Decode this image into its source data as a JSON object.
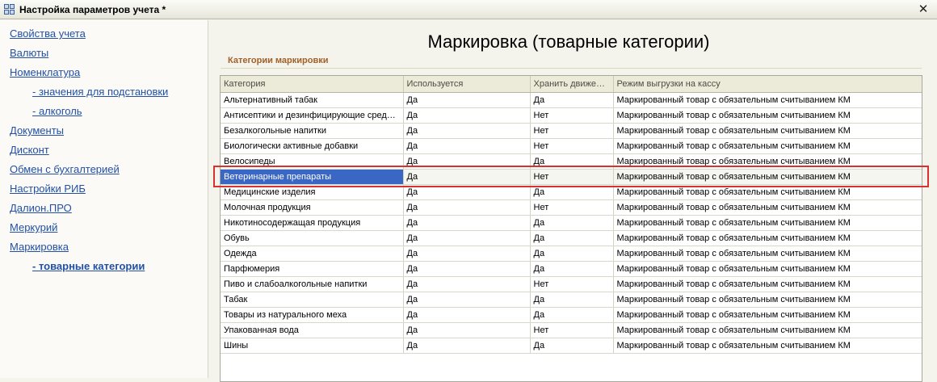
{
  "window": {
    "title": "Настройка параметров учета *"
  },
  "sidebar": {
    "items": [
      {
        "label": "Свойства учета",
        "level": 0,
        "active": false
      },
      {
        "label": "Валюты",
        "level": 0,
        "active": false
      },
      {
        "label": "Номенклатура",
        "level": 0,
        "active": false
      },
      {
        "label": "- значения для подстановки",
        "level": 1,
        "active": false
      },
      {
        "label": "- алкоголь",
        "level": 1,
        "active": false
      },
      {
        "label": "Документы",
        "level": 0,
        "active": false
      },
      {
        "label": "Дисконт",
        "level": 0,
        "active": false
      },
      {
        "label": "Обмен с бухгалтерией",
        "level": 0,
        "active": false
      },
      {
        "label": "Настройки РИБ",
        "level": 0,
        "active": false
      },
      {
        "label": "Далион.ПРО",
        "level": 0,
        "active": false
      },
      {
        "label": "Меркурий",
        "level": 0,
        "active": false
      },
      {
        "label": "Маркировка",
        "level": 0,
        "active": false
      },
      {
        "label": "- товарные категории",
        "level": 1,
        "active": true
      }
    ]
  },
  "main": {
    "title": "Маркировка (товарные категории)",
    "section_label": "Категории маркировки"
  },
  "table": {
    "columns": [
      "Категория",
      "Используется",
      "Хранить движени...",
      "Режим выгрузки на кассу"
    ],
    "selected_row": 5,
    "rows": [
      [
        "Альтернативный табак",
        "Да",
        "Да",
        "Маркированный товар с обязательным считыванием КМ"
      ],
      [
        "Антисептики и дезинфицирующие средст...",
        "Да",
        "Нет",
        "Маркированный товар с обязательным считыванием КМ"
      ],
      [
        "Безалкогольные напитки",
        "Да",
        "Нет",
        "Маркированный товар с обязательным считыванием КМ"
      ],
      [
        "Биологически активные добавки",
        "Да",
        "Нет",
        "Маркированный товар с обязательным считыванием КМ"
      ],
      [
        "Велосипеды",
        "Да",
        "Да",
        "Маркированный товар с обязательным считыванием КМ"
      ],
      [
        "Ветеринарные препараты",
        "Да",
        "Нет",
        "Маркированный товар с обязательным считыванием КМ"
      ],
      [
        "Медицинские изделия",
        "Да",
        "Да",
        "Маркированный товар с обязательным считыванием КМ"
      ],
      [
        "Молочная продукция",
        "Да",
        "Нет",
        "Маркированный товар с обязательным считыванием КМ"
      ],
      [
        "Никотиносодержащая продукция",
        "Да",
        "Да",
        "Маркированный товар с обязательным считыванием КМ"
      ],
      [
        "Обувь",
        "Да",
        "Да",
        "Маркированный товар с обязательным считыванием КМ"
      ],
      [
        "Одежда",
        "Да",
        "Да",
        "Маркированный товар с обязательным считыванием КМ"
      ],
      [
        "Парфюмерия",
        "Да",
        "Да",
        "Маркированный товар с обязательным считыванием КМ"
      ],
      [
        "Пиво и слабоалкогольные напитки",
        "Да",
        "Нет",
        "Маркированный товар с обязательным считыванием КМ"
      ],
      [
        "Табак",
        "Да",
        "Да",
        "Маркированный товар с обязательным считыванием КМ"
      ],
      [
        "Товары из натурального меха",
        "Да",
        "Да",
        "Маркированный товар с обязательным считыванием КМ"
      ],
      [
        "Упакованная вода",
        "Да",
        "Нет",
        "Маркированный товар с обязательным считыванием КМ"
      ],
      [
        "Шины",
        "Да",
        "Да",
        "Маркированный товар с обязательным считыванием КМ"
      ]
    ]
  },
  "colors": {
    "link": "#2250a6",
    "section_label": "#a0612a",
    "selection": "#3a66c4",
    "highlight": "#d8322f"
  }
}
